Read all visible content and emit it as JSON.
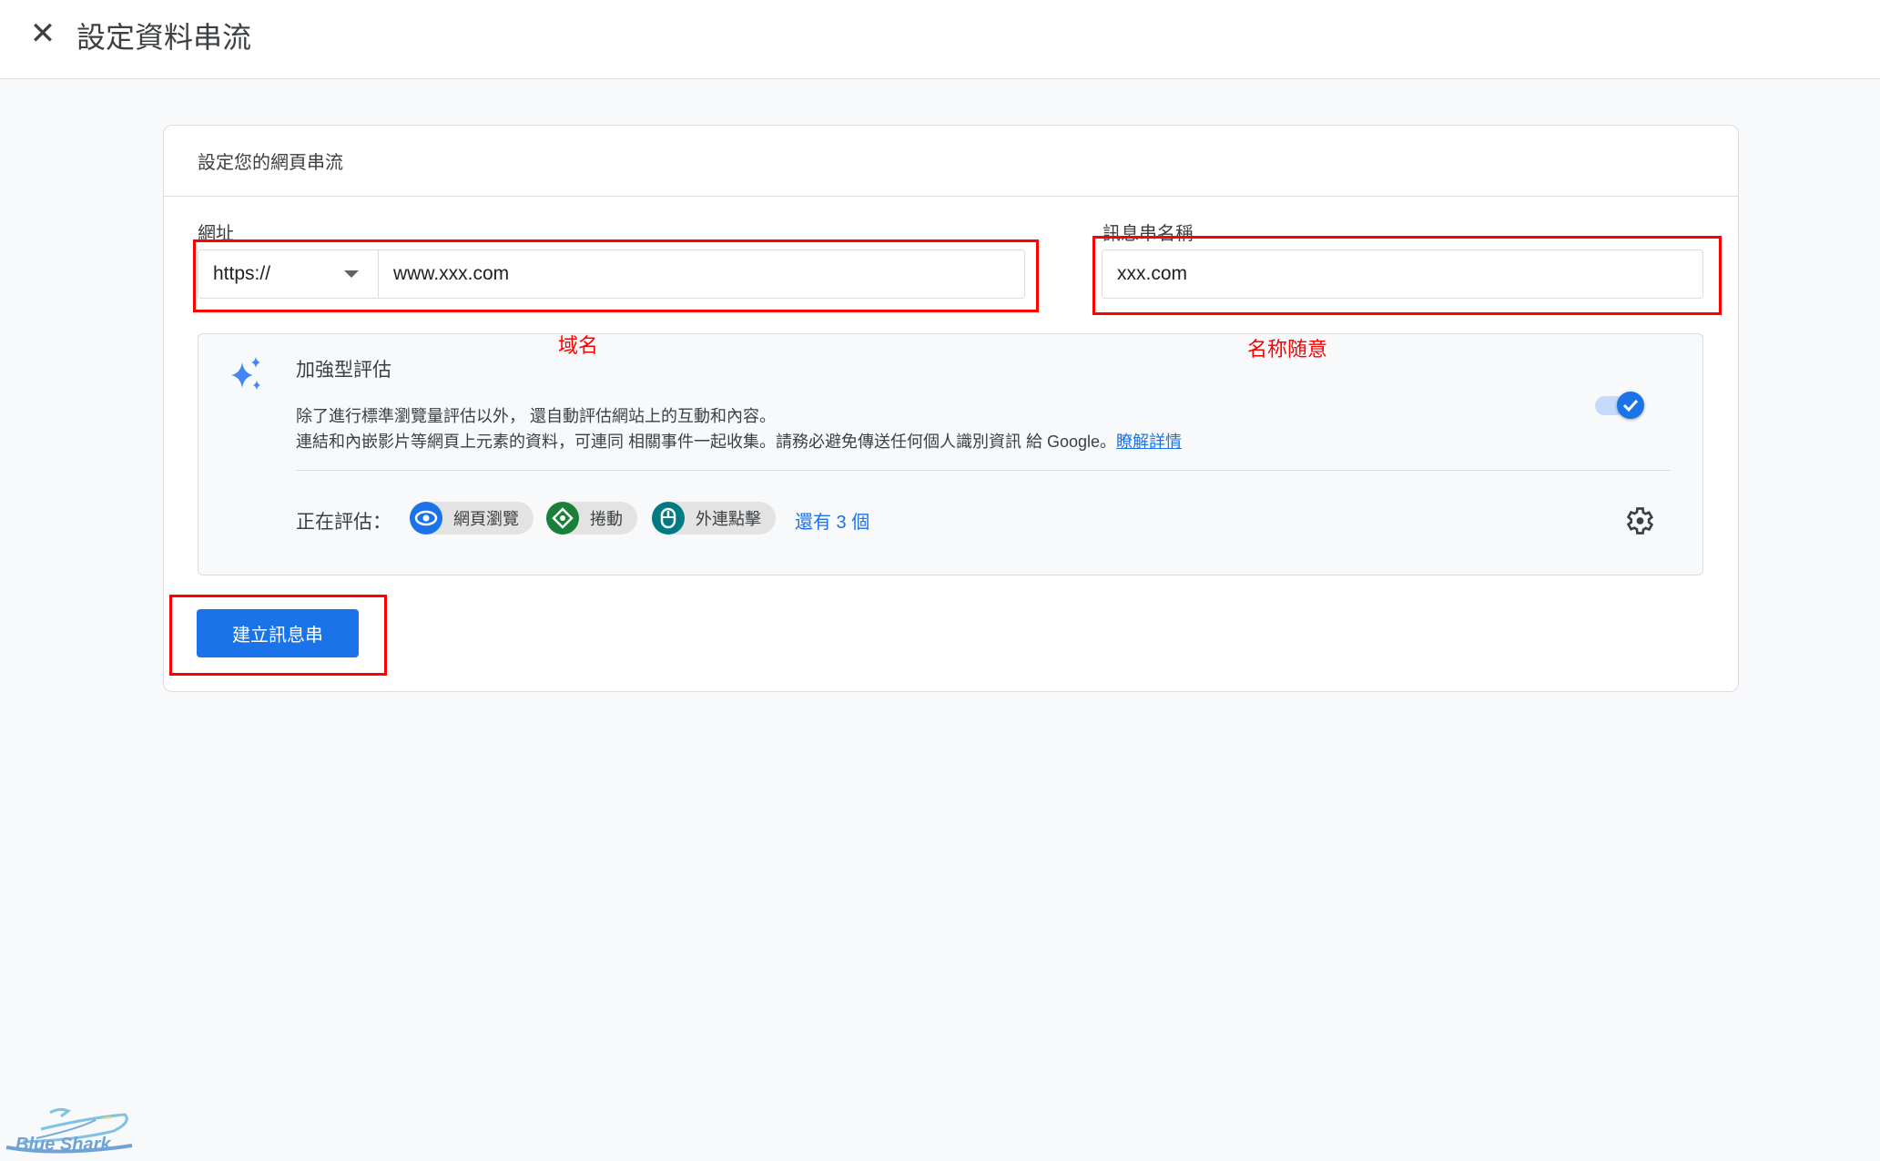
{
  "header": {
    "title": "設定資料串流",
    "close_icon": "close-icon"
  },
  "card": {
    "title": "設定您的網頁串流"
  },
  "url_field": {
    "label": "網址",
    "protocol": "https://",
    "value": "www.xxx.com"
  },
  "stream_name": {
    "label": "訊息串名稱",
    "value": "xxx.com"
  },
  "annotations": {
    "domain": "域名",
    "name": "名称随意",
    "annotation_color": "#ff0000"
  },
  "enhanced": {
    "title": "加強型評估",
    "line1": "除了進行標準瀏覽量評估以外， 還自動評估網站上的互動和內容。",
    "line2": "連結和內嵌影片等網頁上元素的資料，可連同 相關事件一起收集。請務必避免傳送任何個人識別資訊 給 Google。",
    "learn_more": "瞭解詳情",
    "enabled": true,
    "measuring_label": "正在評估：",
    "chips": [
      {
        "label": "網頁瀏覽",
        "icon": "eye-icon",
        "color": "#1a73e8"
      },
      {
        "label": "捲動",
        "icon": "scroll-icon",
        "color": "#188038"
      },
      {
        "label": "外連點擊",
        "icon": "mouse-icon",
        "color": "#007b83"
      }
    ],
    "more": "還有 3 個"
  },
  "create_button": "建立訊息串",
  "logo": {
    "text": "Blue Shark"
  },
  "accent": "#1a73e8"
}
